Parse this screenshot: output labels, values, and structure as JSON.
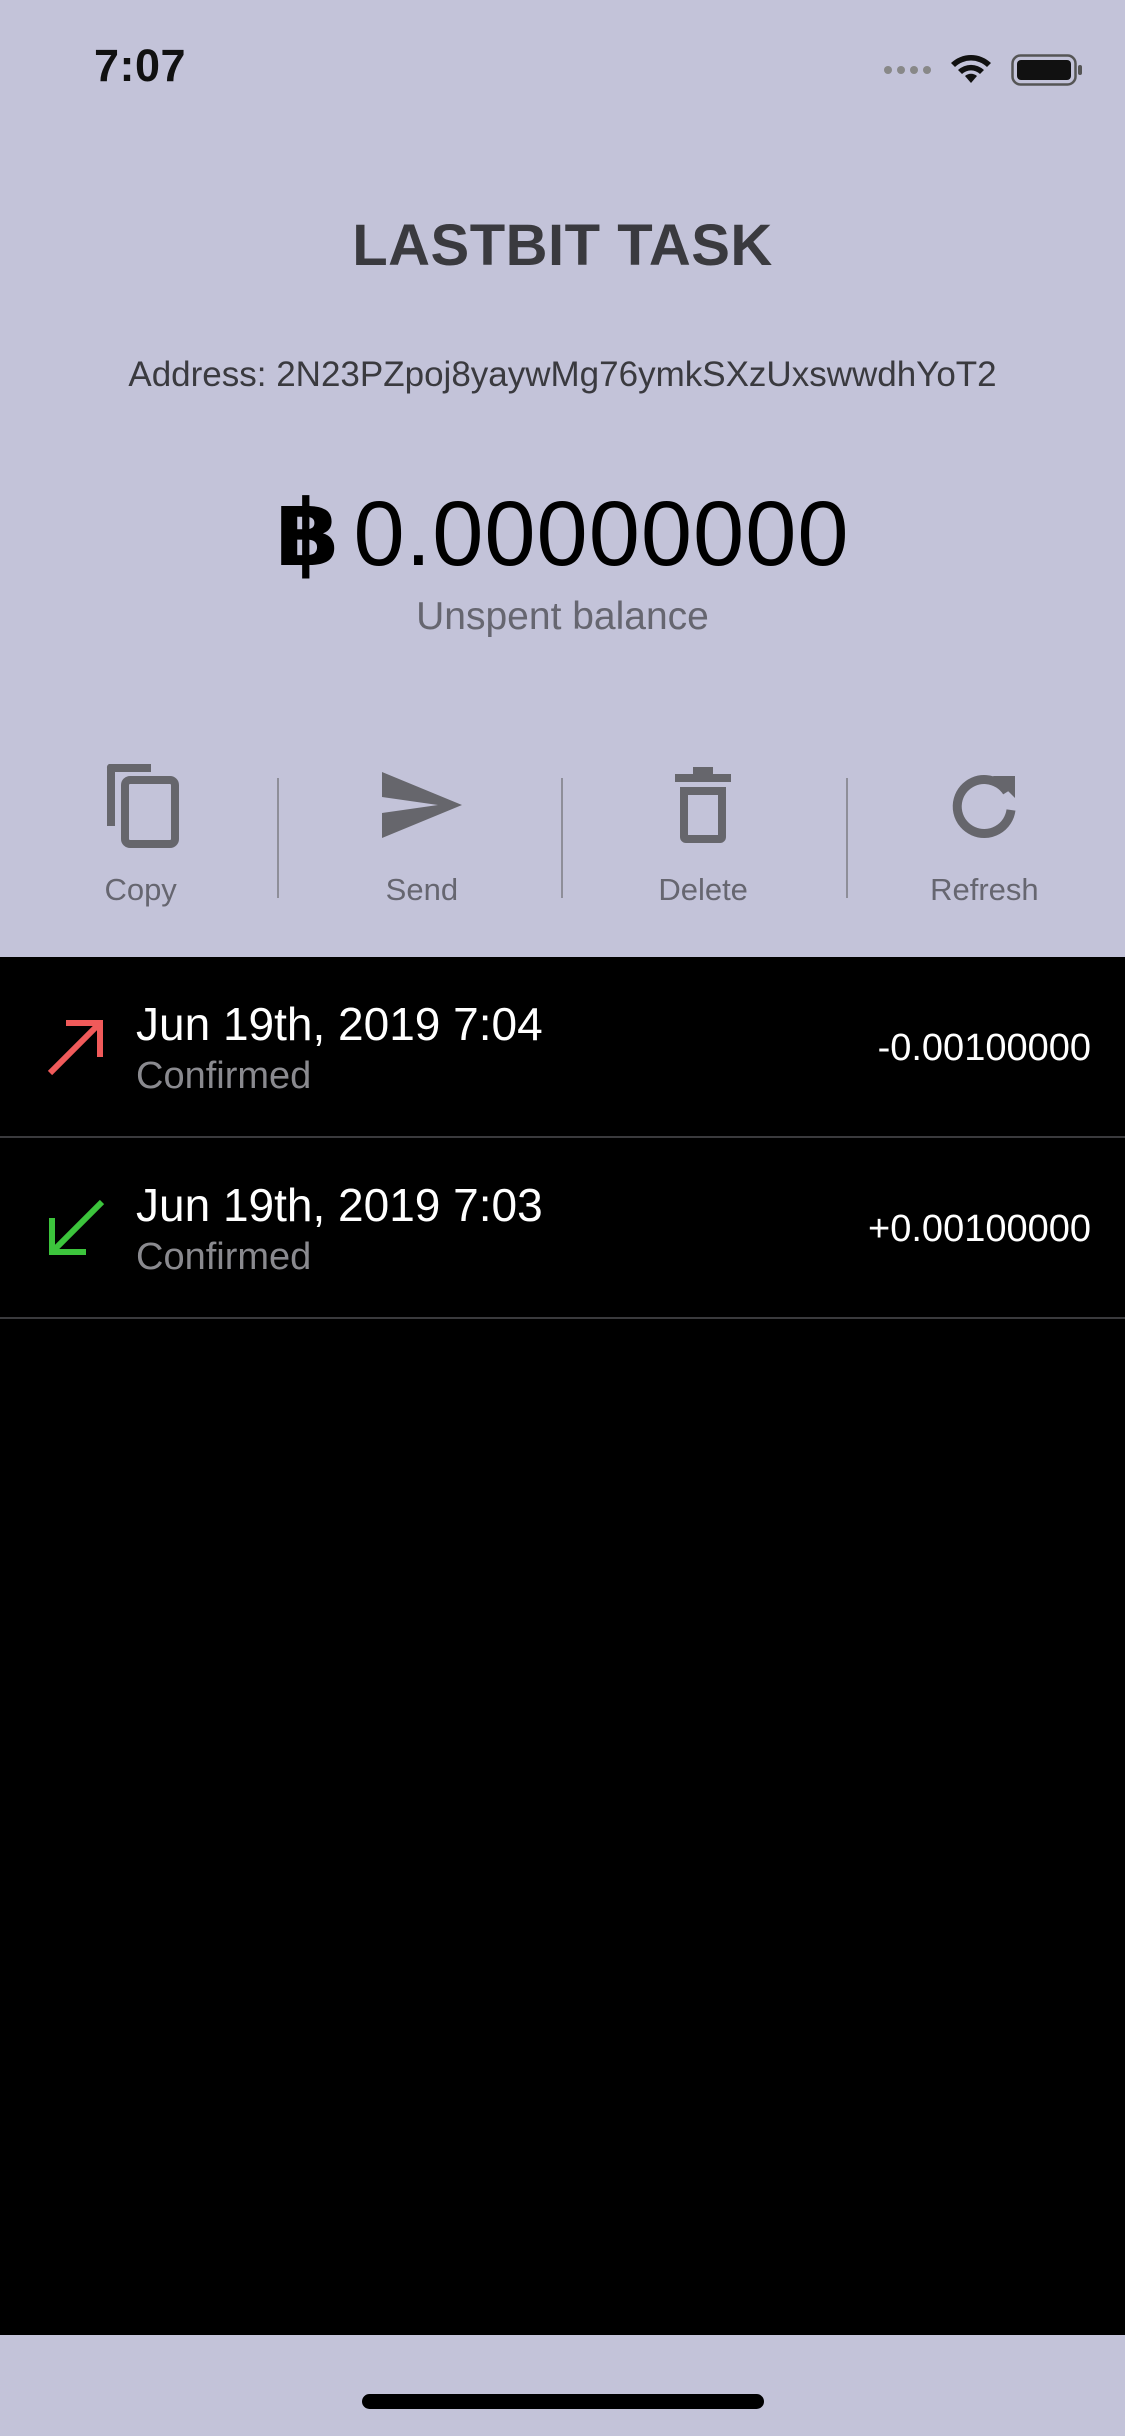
{
  "status_bar": {
    "time": "7:07"
  },
  "header": {
    "title": "LASTBIT TASK",
    "address": "Address: 2N23PZpoj8yaywMg76ymkSXzUxswwdhYoT2"
  },
  "balance": {
    "currency_symbol": "฿",
    "value": "0.00000000",
    "label": "Unspent balance"
  },
  "actions": [
    {
      "label": "Copy",
      "icon": "copy-icon"
    },
    {
      "label": "Send",
      "icon": "send-icon"
    },
    {
      "label": "Delete",
      "icon": "trash-icon"
    },
    {
      "label": "Refresh",
      "icon": "refresh-icon"
    }
  ],
  "transactions": [
    {
      "date": "Jun 19th, 2019 7:04",
      "status": "Confirmed",
      "amount": "-0.00100000",
      "direction": "outgoing",
      "arrow_color": "#f05a5a"
    },
    {
      "date": "Jun 19th, 2019 7:03",
      "status": "Confirmed",
      "amount": "+0.00100000",
      "direction": "incoming",
      "arrow_color": "#3cc43c"
    }
  ],
  "colors": {
    "background": "#c3c3d9",
    "list_background": "#000000",
    "icon_gray": "#66666c"
  }
}
